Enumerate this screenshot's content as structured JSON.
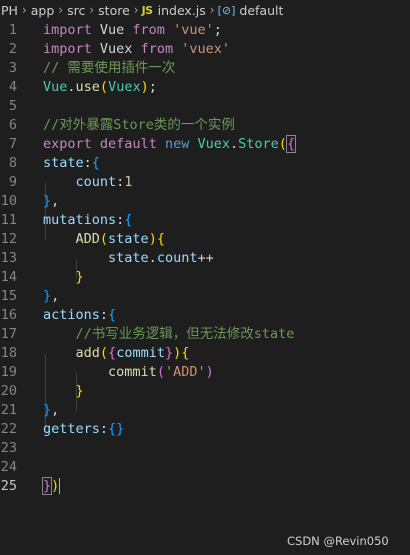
{
  "breadcrumb": {
    "items": [
      "PH",
      "app",
      "src",
      "store",
      "index.js",
      "default"
    ],
    "file_type_label": "JS"
  },
  "editor": {
    "active_line": 25,
    "lines": [
      {
        "n": "1",
        "tokens": [
          {
            "t": "import",
            "c": "kw"
          },
          {
            "t": " Vue ",
            "c": "pun"
          },
          {
            "t": "from",
            "c": "kw"
          },
          {
            "t": " ",
            "c": "pun"
          },
          {
            "t": "'vue'",
            "c": "str"
          },
          {
            "t": ";",
            "c": "pun"
          }
        ]
      },
      {
        "n": "2",
        "tokens": [
          {
            "t": "import",
            "c": "kw"
          },
          {
            "t": " Vuex ",
            "c": "pun"
          },
          {
            "t": "from",
            "c": "kw"
          },
          {
            "t": " ",
            "c": "pun"
          },
          {
            "t": "'vuex'",
            "c": "str"
          }
        ]
      },
      {
        "n": "3",
        "tokens": [
          {
            "t": "// 需要使用插件一次",
            "c": "com"
          }
        ]
      },
      {
        "n": "4",
        "tokens": [
          {
            "t": "Vue",
            "c": "cls"
          },
          {
            "t": ".",
            "c": "pun"
          },
          {
            "t": "use",
            "c": "fn"
          },
          {
            "t": "(",
            "c": "b1"
          },
          {
            "t": "Vuex",
            "c": "cls"
          },
          {
            "t": ")",
            "c": "b1"
          },
          {
            "t": ";",
            "c": "pun"
          }
        ]
      },
      {
        "n": "5",
        "tokens": []
      },
      {
        "n": "6",
        "tokens": [
          {
            "t": "//对外暴露Store类的一个实例",
            "c": "com"
          }
        ]
      },
      {
        "n": "7",
        "tokens": [
          {
            "t": "export",
            "c": "kw"
          },
          {
            "t": " ",
            "c": "pun"
          },
          {
            "t": "default",
            "c": "kw"
          },
          {
            "t": " ",
            "c": "pun"
          },
          {
            "t": "new",
            "c": "kw2"
          },
          {
            "t": " ",
            "c": "pun"
          },
          {
            "t": "Vuex",
            "c": "cls"
          },
          {
            "t": ".",
            "c": "pun"
          },
          {
            "t": "Store",
            "c": "cls"
          },
          {
            "t": "(",
            "c": "b1"
          },
          {
            "t": "{",
            "c": "b2box"
          }
        ]
      },
      {
        "n": "8",
        "tokens": [
          {
            "t": "state",
            "c": "id"
          },
          {
            "t": ":",
            "c": "pun"
          },
          {
            "t": "{",
            "c": "b3"
          }
        ]
      },
      {
        "n": "9",
        "tokens": [
          {
            "t": "    ",
            "c": "pun"
          },
          {
            "t": "count",
            "c": "id"
          },
          {
            "t": ":",
            "c": "pun"
          },
          {
            "t": "1",
            "c": "num"
          }
        ]
      },
      {
        "n": "10",
        "tokens": [
          {
            "t": "}",
            "c": "b3"
          },
          {
            "t": ",",
            "c": "pun"
          }
        ]
      },
      {
        "n": "11",
        "tokens": [
          {
            "t": "mutations",
            "c": "id"
          },
          {
            "t": ":",
            "c": "pun"
          },
          {
            "t": "{",
            "c": "b3"
          }
        ]
      },
      {
        "n": "12",
        "tokens": [
          {
            "t": "    ",
            "c": "pun"
          },
          {
            "t": "ADD",
            "c": "fn"
          },
          {
            "t": "(",
            "c": "b1"
          },
          {
            "t": "state",
            "c": "id"
          },
          {
            "t": ")",
            "c": "b1"
          },
          {
            "t": "{",
            "c": "b1"
          }
        ]
      },
      {
        "n": "13",
        "tokens": [
          {
            "t": "        ",
            "c": "pun"
          },
          {
            "t": "state",
            "c": "id"
          },
          {
            "t": ".",
            "c": "pun"
          },
          {
            "t": "count",
            "c": "id"
          },
          {
            "t": "++",
            "c": "pun"
          }
        ]
      },
      {
        "n": "14",
        "tokens": [
          {
            "t": "    ",
            "c": "pun"
          },
          {
            "t": "}",
            "c": "b1"
          }
        ]
      },
      {
        "n": "15",
        "tokens": [
          {
            "t": "}",
            "c": "b3"
          },
          {
            "t": ",",
            "c": "pun"
          }
        ]
      },
      {
        "n": "16",
        "tokens": [
          {
            "t": "actions",
            "c": "id"
          },
          {
            "t": ":",
            "c": "pun"
          },
          {
            "t": "{",
            "c": "b3"
          }
        ]
      },
      {
        "n": "17",
        "tokens": [
          {
            "t": "    ",
            "c": "pun"
          },
          {
            "t": "//书写业务逻辑，但无法修改state",
            "c": "com"
          }
        ]
      },
      {
        "n": "18",
        "tokens": [
          {
            "t": "    ",
            "c": "pun"
          },
          {
            "t": "add",
            "c": "fn"
          },
          {
            "t": "(",
            "c": "b1"
          },
          {
            "t": "{",
            "c": "b2"
          },
          {
            "t": "commit",
            "c": "id"
          },
          {
            "t": "}",
            "c": "b2"
          },
          {
            "t": ")",
            "c": "b1"
          },
          {
            "t": "{",
            "c": "b1"
          }
        ]
      },
      {
        "n": "19",
        "tokens": [
          {
            "t": "        ",
            "c": "pun"
          },
          {
            "t": "commit",
            "c": "fn"
          },
          {
            "t": "(",
            "c": "b2"
          },
          {
            "t": "'ADD'",
            "c": "str"
          },
          {
            "t": ")",
            "c": "b2"
          }
        ]
      },
      {
        "n": "20",
        "tokens": [
          {
            "t": "    ",
            "c": "pun"
          },
          {
            "t": "}",
            "c": "b1"
          }
        ]
      },
      {
        "n": "21",
        "tokens": [
          {
            "t": "}",
            "c": "b3"
          },
          {
            "t": ",",
            "c": "pun"
          }
        ]
      },
      {
        "n": "22",
        "tokens": [
          {
            "t": "getters",
            "c": "id"
          },
          {
            "t": ":",
            "c": "pun"
          },
          {
            "t": "{}",
            "c": "b3"
          }
        ]
      },
      {
        "n": "23",
        "tokens": []
      },
      {
        "n": "24",
        "tokens": []
      },
      {
        "n": "25",
        "tokens": [
          {
            "t": "}",
            "c": "b2box"
          },
          {
            "t": ")",
            "c": "b1"
          },
          {
            "t": "",
            "c": "caret"
          }
        ]
      }
    ]
  },
  "watermark": {
    "text": "CSDN @Revin050"
  }
}
